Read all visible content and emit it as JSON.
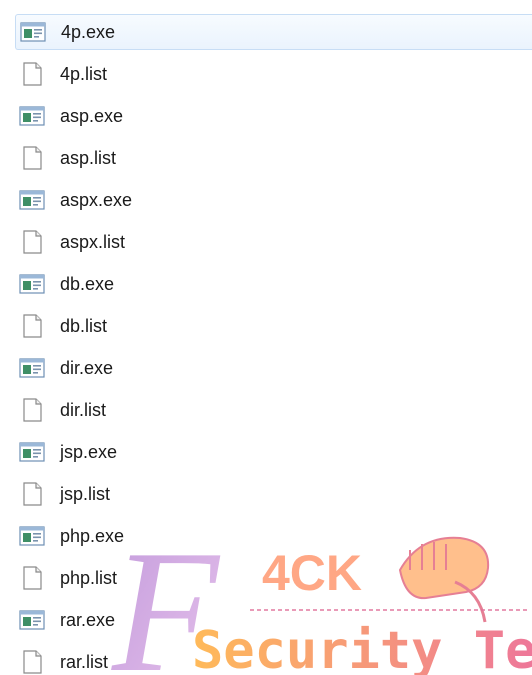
{
  "files": [
    {
      "name": "4p.exe",
      "type": "exe",
      "selected": true
    },
    {
      "name": "4p.list",
      "type": "list"
    },
    {
      "name": "asp.exe",
      "type": "exe"
    },
    {
      "name": "asp.list",
      "type": "list"
    },
    {
      "name": "aspx.exe",
      "type": "exe"
    },
    {
      "name": "aspx.list",
      "type": "list"
    },
    {
      "name": "db.exe",
      "type": "exe"
    },
    {
      "name": "db.list",
      "type": "list"
    },
    {
      "name": "dir.exe",
      "type": "exe"
    },
    {
      "name": "dir.list",
      "type": "list"
    },
    {
      "name": "jsp.exe",
      "type": "exe"
    },
    {
      "name": "jsp.list",
      "type": "list"
    },
    {
      "name": "php.exe",
      "type": "exe"
    },
    {
      "name": "php.list",
      "type": "list"
    },
    {
      "name": "rar.exe",
      "type": "exe"
    },
    {
      "name": "rar.list",
      "type": "list"
    }
  ],
  "icons": {
    "exe": "application-window-icon",
    "list": "blank-document-icon"
  },
  "watermark": {
    "letter": "F",
    "brand": "4CK",
    "tagline": "Security Team",
    "colors": {
      "letter": "#c9a0dc",
      "brand": "#ff8a5c",
      "tagline_start": "#ffb347",
      "tagline_end": "#e85a9c",
      "dash": "#e0709a"
    }
  },
  "colors": {
    "selection_bg": "#eaf3fd",
    "selection_border": "#c7ddf5",
    "text": "#1a1a1a"
  }
}
